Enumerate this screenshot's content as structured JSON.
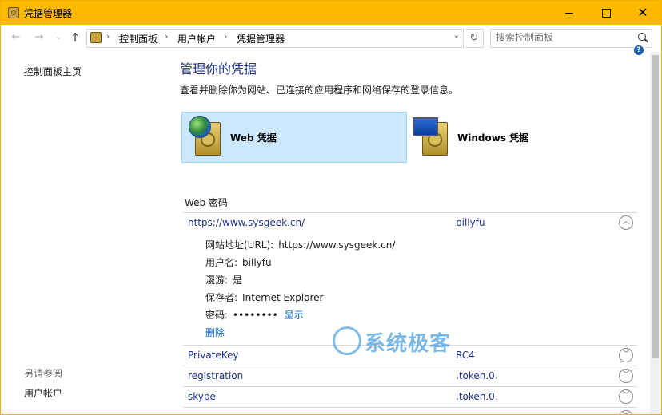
{
  "window": {
    "title": "凭据管理器",
    "accent_color": "#fcb900"
  },
  "address": {
    "crumbs": [
      "控制面板",
      "用户帐户",
      "凭据管理器"
    ],
    "search_placeholder": "搜索控制面板"
  },
  "sidebar": {
    "home": "控制面板主页",
    "see_also": "另请参阅",
    "user_accounts": "用户帐户"
  },
  "main": {
    "heading": "管理你的凭据",
    "description": "查看并删除你为网站、已连接的应用程序和网络保存的登录信息。",
    "tiles": [
      {
        "label": "Web 凭据",
        "icon": "web-credential-icon",
        "selected": true
      },
      {
        "label": "Windows 凭据",
        "icon": "windows-credential-icon",
        "selected": false
      }
    ],
    "section_title": "Web 密码",
    "expanded": {
      "site": "https://www.sysgeek.cn/",
      "user": "billyfu",
      "details": [
        {
          "key": "网站地址(URL):",
          "value": "https://www.sysgeek.cn/"
        },
        {
          "key": "用户名:",
          "value": "billyfu"
        },
        {
          "key": "漫游:",
          "value": "是"
        },
        {
          "key": "保存者:",
          "value": "Internet Explorer"
        },
        {
          "key": "密码:",
          "value": "••••••••"
        }
      ],
      "show_label": "显示",
      "delete_label": "删除"
    },
    "rows": [
      {
        "site": "PrivateKey",
        "user": "RC4"
      },
      {
        "site": "registration",
        "user": ".token.0."
      },
      {
        "site": "skype",
        "user": ".token.0."
      }
    ]
  },
  "watermark": {
    "text": "系统极客"
  }
}
